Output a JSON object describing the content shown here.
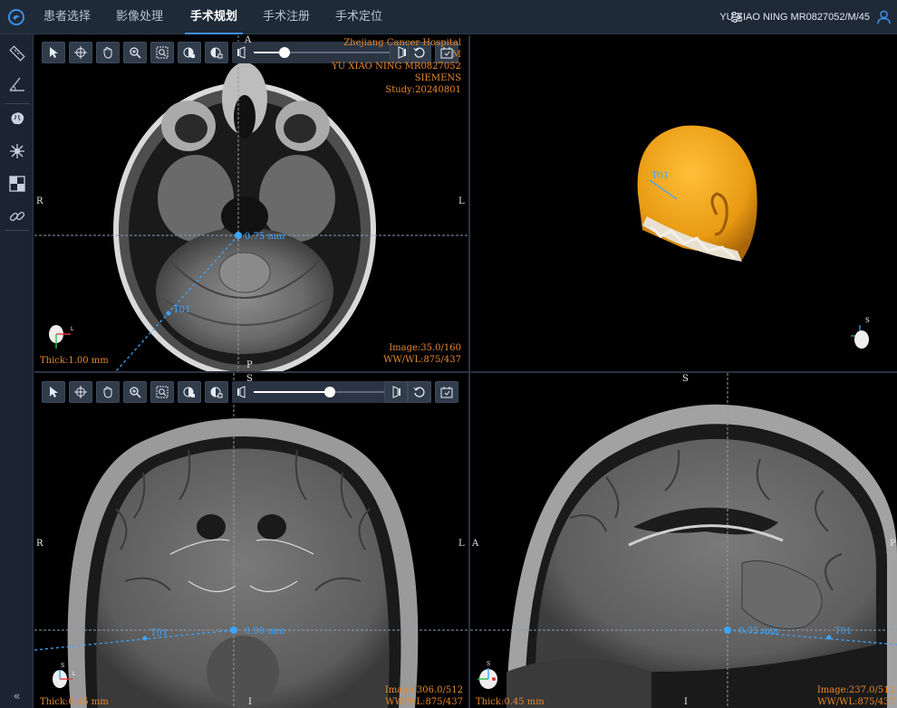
{
  "app": {
    "nav": [
      {
        "label": "患者选择",
        "active": false
      },
      {
        "label": "影像处理",
        "active": false
      },
      {
        "label": "手术规划",
        "active": true
      },
      {
        "label": "手术注册",
        "active": false
      },
      {
        "label": "手术定位",
        "active": false
      }
    ],
    "patient_label": "YU XIAO NING MR0827052/M/45"
  },
  "sidebar": {
    "tools": [
      "ruler-icon",
      "angle-icon",
      "brain-icon",
      "spider-tool-icon",
      "checker-icon",
      "link-icon"
    ],
    "collapse": "«"
  },
  "axial": {
    "hospital": "Zhejiang Cancer Hospital",
    "hospital_line2": "M",
    "patient": "YU XIAO NING MR0827052",
    "manufacturer": "SIEMENS",
    "study": "Study:20240801",
    "image": "Image:35.0/160",
    "wwwl": "WW/WL:875/437",
    "thick": "Thick:1.00 mm",
    "measure": "0.75 mm",
    "trajectory": "T01",
    "orient": {
      "top": "A",
      "bottom": "P",
      "left": "R",
      "right": "L"
    },
    "slider_value": 0.3
  },
  "volume": {
    "label": "T01",
    "orient_marker": "S"
  },
  "coronal": {
    "image": "Image:306.0/512",
    "wwwl": "WW/WL:875/437",
    "thick": "Thick:0.45 mm",
    "measure": "0.90 mm",
    "trajectory": "T01",
    "orient": {
      "top": "S",
      "bottom": "I",
      "left": "R",
      "right": "L"
    },
    "slider_value": 0.6
  },
  "sagittal": {
    "image": "Image:237.0/512",
    "wwwl": "WW/WL:875/437",
    "thick": "Thick:0.45 mm",
    "measure": "0.75 mm",
    "trajectory": "T01",
    "orient": {
      "top": "S",
      "bottom": "I",
      "left": "A",
      "right": "P"
    }
  },
  "colors": {
    "accent": "#3e8ee8",
    "overlay_text": "#e8892c",
    "measure": "#3aa6ff",
    "crosshair": "#8f9aa8",
    "volume": "#f0a018"
  }
}
